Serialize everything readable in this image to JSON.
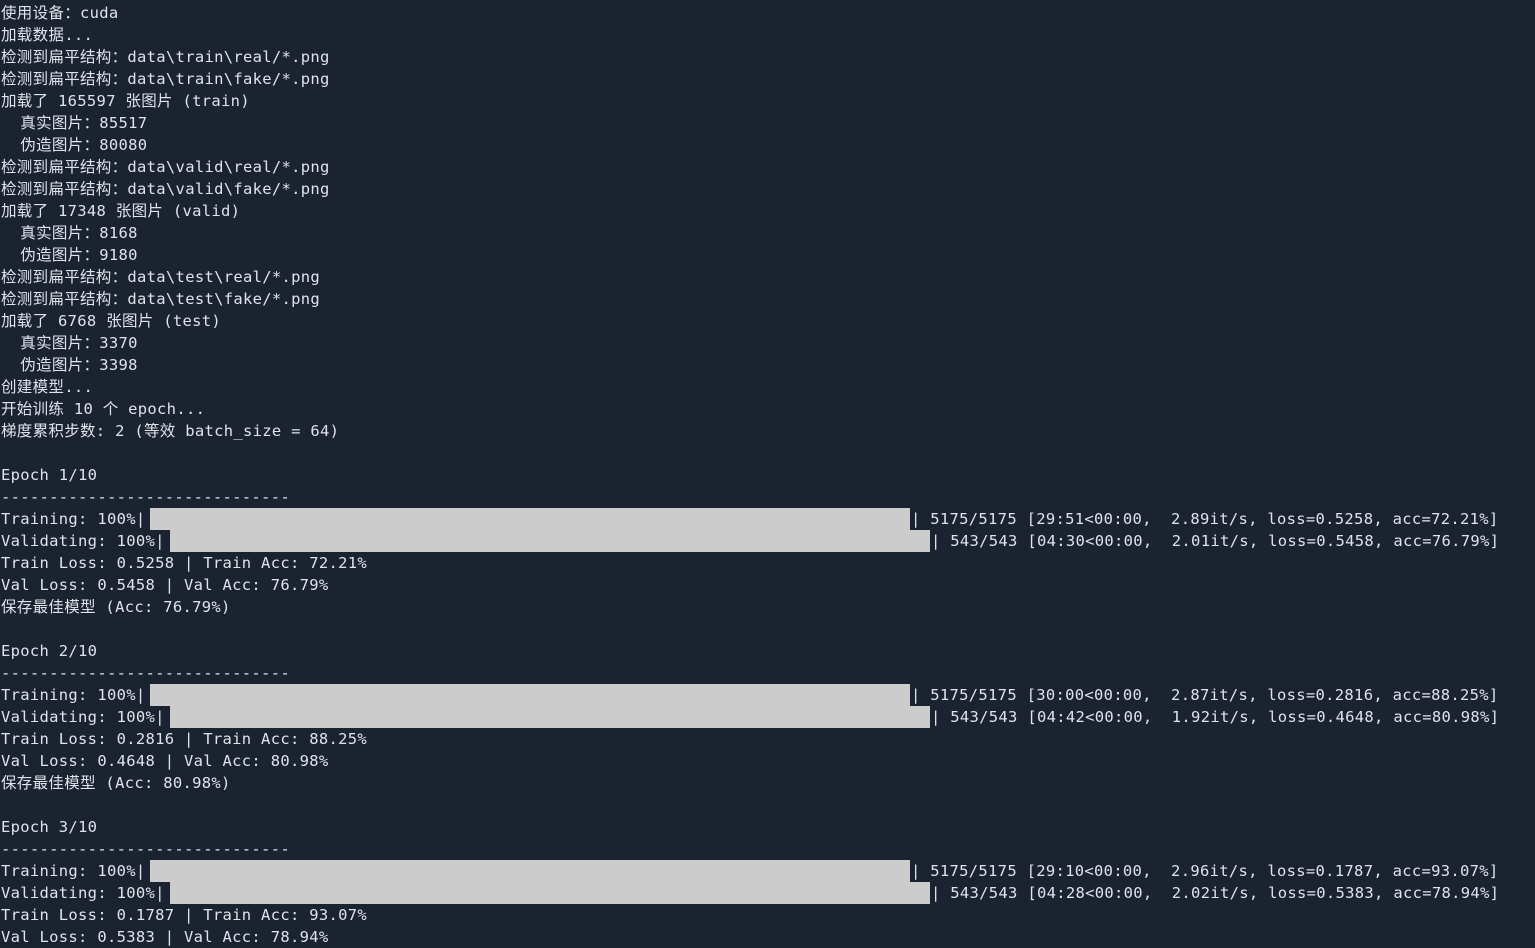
{
  "lines": [
    "使用设备：cuda",
    "加载数据...",
    "检测到扁平结构：data\\train\\real/*.png",
    "检测到扁平结构：data\\train\\fake/*.png",
    "加载了 165597 张图片 (train)",
    "  真实图片：85517",
    "  伪造图片：80080",
    "检测到扁平结构：data\\valid\\real/*.png",
    "检测到扁平结构：data\\valid\\fake/*.png",
    "加载了 17348 张图片 (valid)",
    "  真实图片：8168",
    "  伪造图片：9180",
    "检测到扁平结构：data\\test\\real/*.png",
    "检测到扁平结构：data\\test\\fake/*.png",
    "加载了 6768 张图片 (test)",
    "  真实图片：3370",
    "  伪造图片：3398",
    "创建模型...",
    "开始训练 10 个 epoch...",
    "梯度累积步数: 2 (等效 batch_size = 64)",
    "",
    "Epoch 1/10",
    "------------------------------",
    {
      "label": "Training: 100%|",
      "progress": 1.0,
      "stats": "| 5175/5175 [29:51<00:00,  2.89it/s, loss=0.5258, acc=72.21%]",
      "kind": "train"
    },
    {
      "label": "Validating: 100%|",
      "progress": 1.0,
      "stats": "| 543/543 [04:30<00:00,  2.01it/s, loss=0.5458, acc=76.79%]",
      "kind": "valid"
    },
    "Train Loss: 0.5258 | Train Acc: 72.21%",
    "Val Loss: 0.5458 | Val Acc: 76.79%",
    "保存最佳模型 (Acc: 76.79%)",
    "",
    "Epoch 2/10",
    "------------------------------",
    {
      "label": "Training: 100%|",
      "progress": 1.0,
      "stats": "| 5175/5175 [30:00<00:00,  2.87it/s, loss=0.2816, acc=88.25%]",
      "kind": "train"
    },
    {
      "label": "Validating: 100%|",
      "progress": 1.0,
      "stats": "| 543/543 [04:42<00:00,  1.92it/s, loss=0.4648, acc=80.98%]",
      "kind": "valid"
    },
    "Train Loss: 0.2816 | Train Acc: 88.25%",
    "Val Loss: 0.4648 | Val Acc: 80.98%",
    "保存最佳模型 (Acc: 80.98%)",
    "",
    "Epoch 3/10",
    "------------------------------",
    {
      "label": "Training: 100%|",
      "progress": 1.0,
      "stats": "| 5175/5175 [29:10<00:00,  2.96it/s, loss=0.1787, acc=93.07%]",
      "kind": "train"
    },
    {
      "label": "Validating: 100%|",
      "progress": 1.0,
      "stats": "| 543/543 [04:28<00:00,  2.02it/s, loss=0.5383, acc=78.94%]",
      "kind": "valid"
    },
    "Train Loss: 0.1787 | Train Acc: 93.07%",
    "Val Loss: 0.5383 | Val Acc: 78.94%"
  ]
}
